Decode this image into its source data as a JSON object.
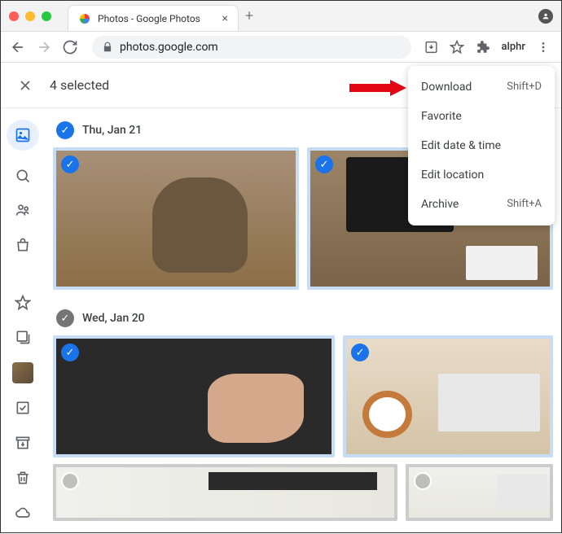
{
  "browser": {
    "tab_title": "Photos - Google Photos",
    "url": "photos.google.com",
    "brand": "alphr"
  },
  "selection": {
    "count_label": "4 selected"
  },
  "dates": [
    {
      "label": "Thu, Jan 21",
      "checked": true
    },
    {
      "label": "Wed, Jan 20",
      "checked": false
    }
  ],
  "menu": {
    "items": [
      {
        "label": "Download",
        "shortcut": "Shift+D"
      },
      {
        "label": "Favorite",
        "shortcut": ""
      },
      {
        "label": "Edit date & time",
        "shortcut": ""
      },
      {
        "label": "Edit location",
        "shortcut": ""
      },
      {
        "label": "Archive",
        "shortcut": "Shift+A"
      }
    ]
  }
}
